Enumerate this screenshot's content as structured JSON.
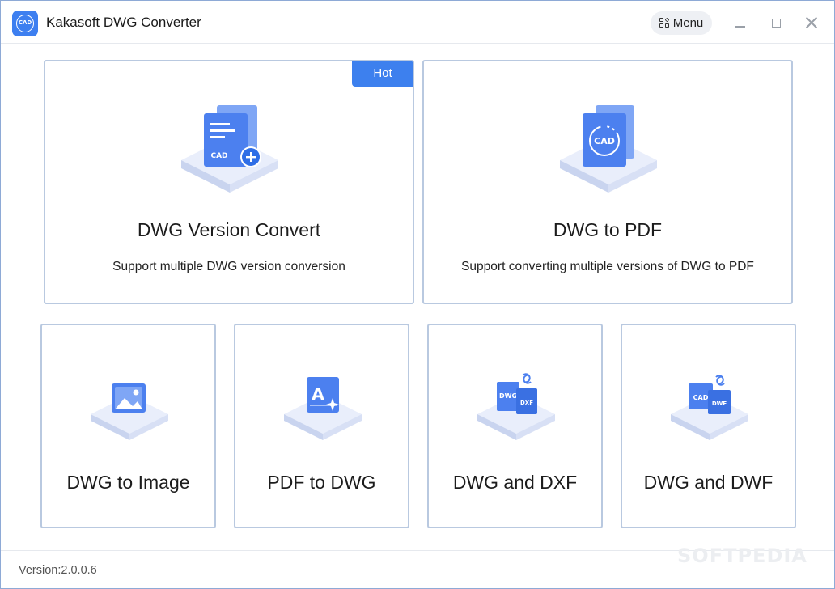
{
  "window": {
    "title": "Kakasoft DWG Converter",
    "logo_text": "CAD",
    "menu_label": "Menu"
  },
  "cards_top": [
    {
      "title": "DWG Version Convert",
      "description": "Support multiple DWG version conversion",
      "badge": "Hot",
      "icon_text": "CAD"
    },
    {
      "title": "DWG to PDF",
      "description": "Support converting multiple versions of DWG to PDF",
      "icon_text": "CAD"
    }
  ],
  "cards_bottom": [
    {
      "title": "DWG to Image"
    },
    {
      "title": "PDF to DWG",
      "icon_text": "A"
    },
    {
      "title": "DWG and DXF",
      "icon_text_1": "DWG",
      "icon_text_2": "DXF"
    },
    {
      "title": "DWG and DWF",
      "icon_text_1": "CAD",
      "icon_text_2": "DWF"
    }
  ],
  "footer": {
    "version": "Version:2.0.0.6"
  },
  "watermark": "SOFTPEDIA",
  "colors": {
    "accent": "#3d80ee",
    "card_border": "#b9c9e0",
    "icon_blue": "#4a7ff0"
  }
}
